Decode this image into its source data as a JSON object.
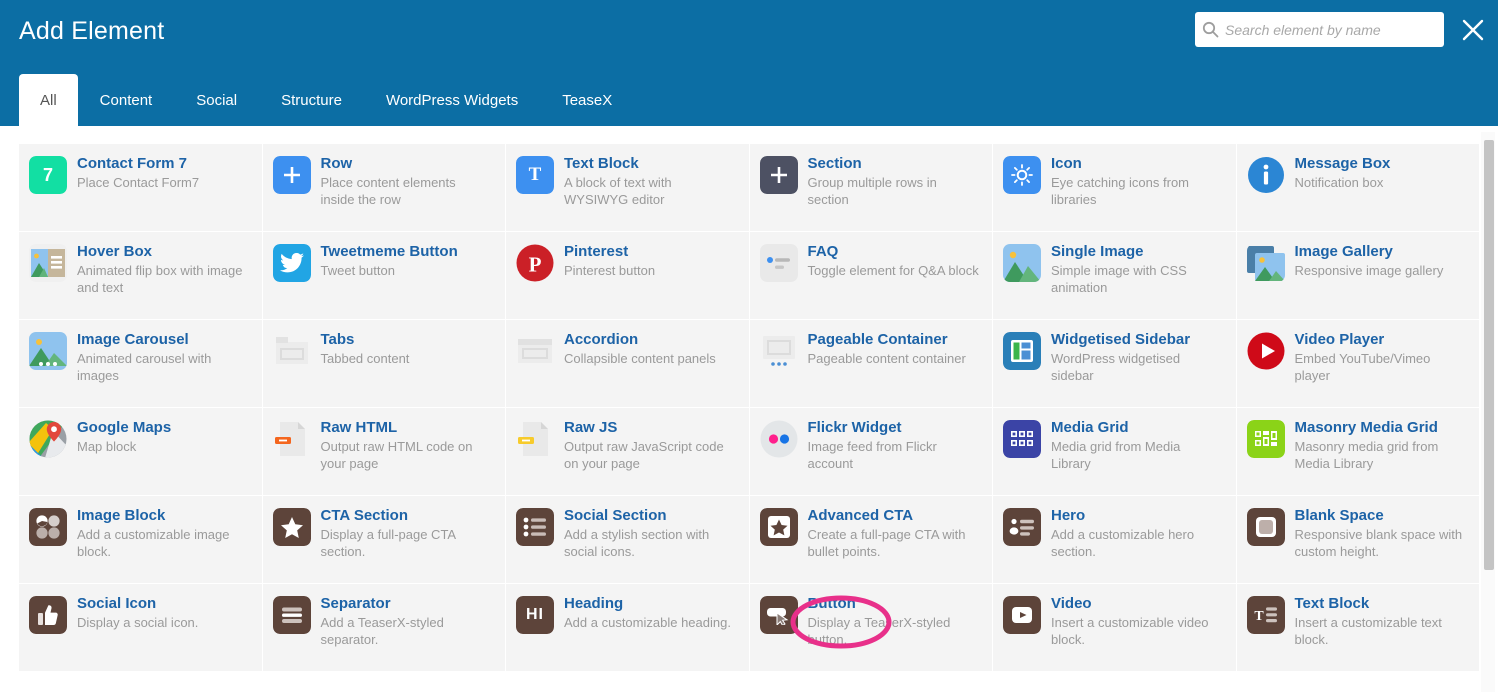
{
  "header": {
    "title": "Add Element",
    "close_label": "×",
    "search": {
      "placeholder": "Search element by name",
      "value": "",
      "icon": "search-icon"
    },
    "accent_color": "#0c6ea4"
  },
  "tabs": [
    {
      "label": "All",
      "active": true
    },
    {
      "label": "Content",
      "active": false
    },
    {
      "label": "Social",
      "active": false
    },
    {
      "label": "Structure",
      "active": false
    },
    {
      "label": "WordPress Widgets",
      "active": false
    },
    {
      "label": "TeaseX",
      "active": false
    }
  ],
  "annotation": {
    "shape": "ellipse",
    "color": "#e8308a",
    "targets": "Button",
    "stroke_width": 5
  },
  "elements": [
    {
      "name": "Contact Form 7",
      "desc": "Place Contact Form7",
      "icon": "contact-form-7-icon"
    },
    {
      "name": "Row",
      "desc": "Place content elements inside the row",
      "icon": "plus-icon"
    },
    {
      "name": "Text Block",
      "desc": "A block of text with WYSIWYG editor",
      "icon": "text-t-icon"
    },
    {
      "name": "Section",
      "desc": "Group multiple rows in section",
      "icon": "plus-dark-icon"
    },
    {
      "name": "Icon",
      "desc": "Eye catching icons from libraries",
      "icon": "sun-icon"
    },
    {
      "name": "Message Box",
      "desc": "Notification box",
      "icon": "info-circle-icon"
    },
    {
      "name": "Hover Box",
      "desc": "Animated flip box with image and text",
      "icon": "hover-box-icon"
    },
    {
      "name": "Tweetmeme Button",
      "desc": "Tweet button",
      "icon": "twitter-icon"
    },
    {
      "name": "Pinterest",
      "desc": "Pinterest button",
      "icon": "pinterest-icon"
    },
    {
      "name": "FAQ",
      "desc": "Toggle element for Q&A block",
      "icon": "faq-icon"
    },
    {
      "name": "Single Image",
      "desc": "Simple image with CSS animation",
      "icon": "single-image-icon"
    },
    {
      "name": "Image Gallery",
      "desc": "Responsive image gallery",
      "icon": "image-gallery-icon"
    },
    {
      "name": "Image Carousel",
      "desc": "Animated carousel with images",
      "icon": "image-carousel-icon"
    },
    {
      "name": "Tabs",
      "desc": "Tabbed content",
      "icon": "tabs-icon"
    },
    {
      "name": "Accordion",
      "desc": "Collapsible content panels",
      "icon": "accordion-icon"
    },
    {
      "name": "Pageable Container",
      "desc": "Pageable content container",
      "icon": "pageable-container-icon"
    },
    {
      "name": "Widgetised Sidebar",
      "desc": "WordPress widgetised sidebar",
      "icon": "sidebar-icon"
    },
    {
      "name": "Video Player",
      "desc": "Embed YouTube/Vimeo player",
      "icon": "youtube-play-icon"
    },
    {
      "name": "Google Maps",
      "desc": "Map block",
      "icon": "google-maps-icon"
    },
    {
      "name": "Raw HTML",
      "desc": "Output raw HTML code on your page",
      "icon": "raw-html-file-icon"
    },
    {
      "name": "Raw JS",
      "desc": "Output raw JavaScript code on your page",
      "icon": "raw-js-file-icon"
    },
    {
      "name": "Flickr Widget",
      "desc": "Image feed from Flickr account",
      "icon": "flickr-icon"
    },
    {
      "name": "Media Grid",
      "desc": "Media grid from Media Library",
      "icon": "media-grid-icon"
    },
    {
      "name": "Masonry Media Grid",
      "desc": "Masonry media grid from Media Library",
      "icon": "masonry-grid-icon"
    },
    {
      "name": "Image Block",
      "desc": "Add a customizable image block.",
      "icon": "image-block-icon"
    },
    {
      "name": "CTA Section",
      "desc": "Display a full-page CTA section.",
      "icon": "star-icon"
    },
    {
      "name": "Social Section",
      "desc": "Add a stylish section with social icons.",
      "icon": "social-list-icon"
    },
    {
      "name": "Advanced CTA",
      "desc": "Create a full-page CTA with bullet points.",
      "icon": "star-box-icon"
    },
    {
      "name": "Hero",
      "desc": "Add a customizable hero section.",
      "icon": "hero-icon"
    },
    {
      "name": "Blank Space",
      "desc": "Responsive blank space with custom height.",
      "icon": "blank-space-icon"
    },
    {
      "name": "Social Icon",
      "desc": "Display a social icon.",
      "icon": "thumbs-up-icon"
    },
    {
      "name": "Separator",
      "desc": "Add a TeaserX-styled separator.",
      "icon": "separator-icon"
    },
    {
      "name": "Heading",
      "desc": "Add a customizable heading.",
      "icon": "heading-h1-icon"
    },
    {
      "name": "Button",
      "desc": "Display a TeaserX-styled button.",
      "icon": "button-cursor-icon"
    },
    {
      "name": "Video",
      "desc": "Insert a customizable video block.",
      "icon": "video-play-icon"
    },
    {
      "name": "Text Block",
      "desc": "Insert a customizable text block.",
      "icon": "text-block-icon"
    }
  ]
}
